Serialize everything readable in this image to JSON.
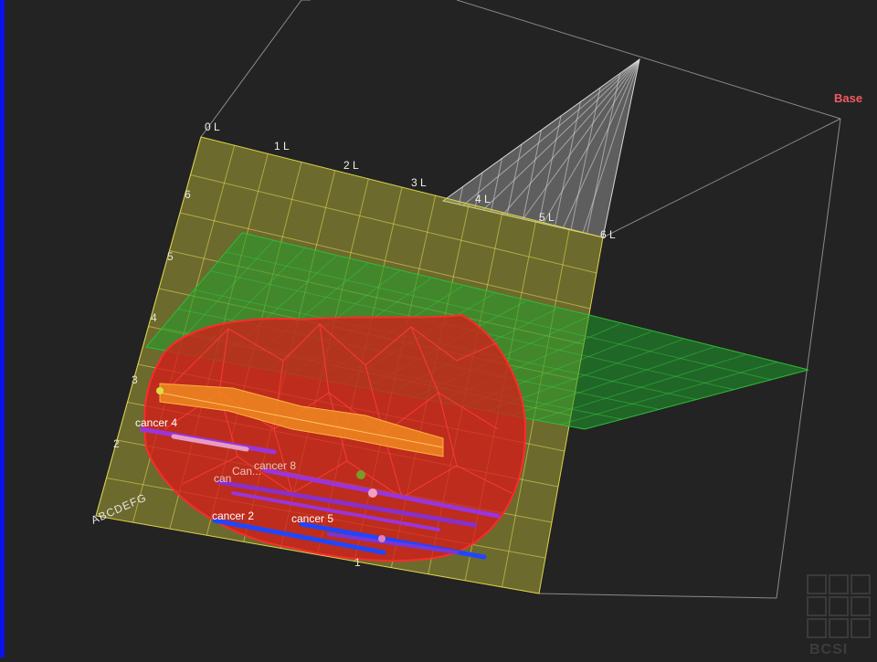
{
  "viewer": {
    "base_label": "Base",
    "logo_text": "BCSI",
    "row_letters": "ABCDEFG",
    "accent_colors": {
      "prostate": "#d81818",
      "grid_plane": "#c8c23a",
      "axial_plane": "#1f9f2a",
      "sagittal_plane": "#cfcfcf",
      "urethra": "#f08a20",
      "core_blue": "#1f46ff",
      "core_purple": "#9a35d8"
    }
  },
  "grid_columns": [
    "0 L",
    "1 L",
    "2 L",
    "3 L",
    "4 L",
    "5 L",
    "6 L"
  ],
  "axis_numbers": [
    "6",
    "5",
    "4",
    "3",
    "2",
    "1"
  ],
  "cancer_labels": {
    "c4": "cancer 4",
    "c8": "cancer 8",
    "ca": "Can...",
    "can": "can",
    "c2": "cancer 2",
    "c5": "cancer 5"
  }
}
